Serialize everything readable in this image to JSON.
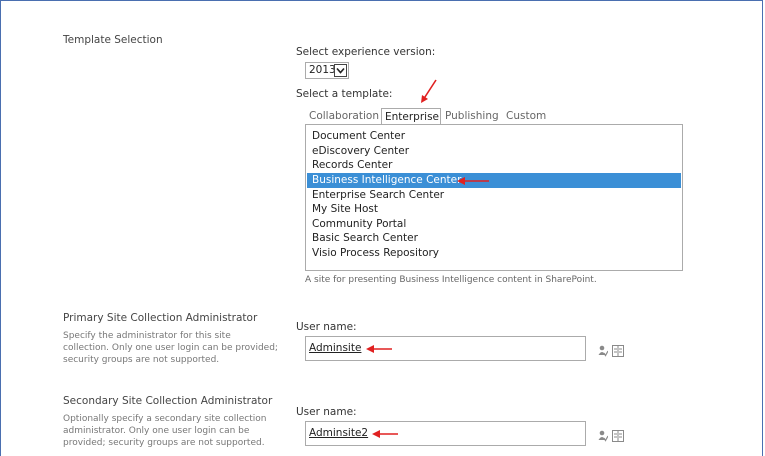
{
  "template_section": {
    "title": "Template Selection",
    "version_label": "Select experience version:",
    "version_value": "2013",
    "template_label": "Select a template:",
    "tabs": [
      "Collaboration",
      "Enterprise",
      "Publishing",
      "Custom"
    ],
    "active_tab": "Enterprise",
    "templates": [
      "Document Center",
      "eDiscovery Center",
      "Records Center",
      "Business Intelligence Center",
      "Enterprise Search Center",
      "My Site Host",
      "Community Portal",
      "Basic Search Center",
      "Visio Process Repository"
    ],
    "selected_template": "Business Intelligence Center",
    "description": "A site for presenting Business Intelligence content in SharePoint."
  },
  "primary_admin": {
    "title": "Primary Site Collection Administrator",
    "description": "Specify the administrator for this site collection. Only one user login can be provided; security groups are not supported.",
    "field_label": "User name:",
    "value": "Adminsite"
  },
  "secondary_admin": {
    "title": "Secondary Site Collection Administrator",
    "description": "Optionally specify a secondary site collection administrator. Only one user login can be provided; security groups are not supported.",
    "field_label": "User name:",
    "value": "Adminsite2"
  },
  "colors": {
    "selection": "#3b8fd6",
    "annotation_arrow": "#e02020",
    "frame": "#4a6fb0"
  },
  "icons": {
    "check_names": "check-names-icon",
    "browse": "address-book-icon"
  }
}
